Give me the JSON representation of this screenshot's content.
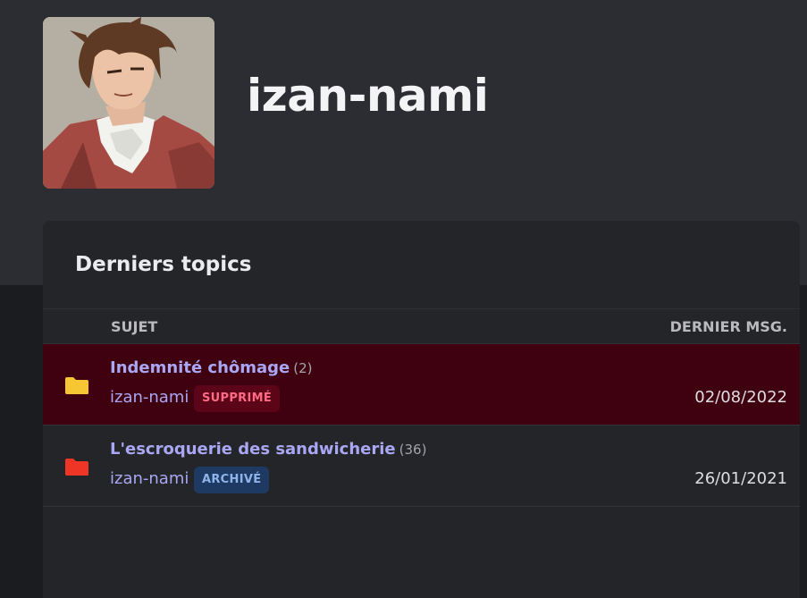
{
  "profile": {
    "username": "izan-nami",
    "avatar_icon": "anime-character-portrait"
  },
  "topics_card": {
    "title": "Derniers topics",
    "columns": {
      "subject": "SUJET",
      "last_message": "DERNIER MSG."
    },
    "rows": [
      {
        "title": "Indemnité chômage",
        "count": "(2)",
        "author": "izan-nami",
        "badge": "SUPPRIMÉ",
        "date": "02/08/2022",
        "folder_icon": "folder-yellow-icon",
        "folder_color": "#f6c633",
        "row_background": "#3f0010"
      },
      {
        "title": "L'escroquerie des sandwicherie",
        "count": "(36)",
        "author": "izan-nami",
        "badge": "ARCHIVÉ",
        "date": "26/01/2021",
        "folder_icon": "folder-red-icon",
        "folder_color": "#ee3526"
      }
    ]
  },
  "colors": {
    "banner": "#2c2d32",
    "page_background": "#1b1c1f",
    "card_background": "#242528",
    "link": "#a9a7f4",
    "badge_deleted_bg": "#5c0518",
    "badge_deleted_text": "#ff6b85",
    "badge_archived_bg": "#1f3a62",
    "badge_archived_text": "#8fb4ea"
  }
}
